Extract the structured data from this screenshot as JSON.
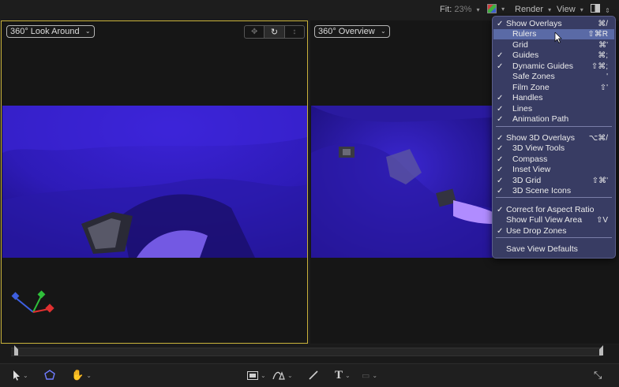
{
  "toolbar": {
    "fit_label": "Fit:",
    "fit_value": "23%",
    "render_label": "Render",
    "view_label": "View",
    "channels_icon": "color-channels-icon",
    "layout_icon": "viewport-layout-icon"
  },
  "left_viewport": {
    "camera_popup": "360° Look Around",
    "tools": [
      "pan-icon",
      "orbit-icon",
      "dolly-icon"
    ]
  },
  "right_viewport": {
    "camera_popup": "360° Overview"
  },
  "view_menu": {
    "items": [
      {
        "label": "Show Overlays",
        "checked": true,
        "shortcut": "⌘/",
        "indent": false
      },
      {
        "label": "Rulers",
        "checked": false,
        "shortcut": "⇧⌘R",
        "indent": true,
        "highlighted": true
      },
      {
        "label": "Grid",
        "checked": false,
        "shortcut": "⌘'",
        "indent": true
      },
      {
        "label": "Guides",
        "checked": true,
        "shortcut": "⌘;",
        "indent": true
      },
      {
        "label": "Dynamic Guides",
        "checked": true,
        "shortcut": "⇧⌘;",
        "indent": true
      },
      {
        "label": "Safe Zones",
        "checked": false,
        "shortcut": "'",
        "indent": true
      },
      {
        "label": "Film Zone",
        "checked": false,
        "shortcut": "⇧'",
        "indent": true
      },
      {
        "label": "Handles",
        "checked": true,
        "shortcut": "",
        "indent": true
      },
      {
        "label": "Lines",
        "checked": true,
        "shortcut": "",
        "indent": true
      },
      {
        "label": "Animation Path",
        "checked": true,
        "shortcut": "",
        "indent": true
      },
      {
        "label": "Show 3D Overlays",
        "checked": true,
        "shortcut": "⌥⌘/",
        "indent": false
      },
      {
        "label": "3D View Tools",
        "checked": true,
        "shortcut": "",
        "indent": true
      },
      {
        "label": "Compass",
        "checked": true,
        "shortcut": "",
        "indent": true
      },
      {
        "label": "Inset View",
        "checked": true,
        "shortcut": "",
        "indent": true
      },
      {
        "label": "3D Grid",
        "checked": true,
        "shortcut": "⇧⌘'",
        "indent": true
      },
      {
        "label": "3D Scene Icons",
        "checked": true,
        "shortcut": "",
        "indent": true
      },
      {
        "label": "Correct for Aspect Ratio",
        "checked": true,
        "shortcut": "",
        "indent": false
      },
      {
        "label": "Show Full View Area",
        "checked": false,
        "shortcut": "⇧V",
        "indent": false
      },
      {
        "label": "Use Drop Zones",
        "checked": true,
        "shortcut": "",
        "indent": false
      },
      {
        "label": "Save View Defaults",
        "checked": false,
        "shortcut": "",
        "indent": false
      }
    ],
    "check_glyph": "✓"
  },
  "bottom_tools": {
    "select_tool": "arrow-select-icon",
    "shape_tool": "3d-transform-icon",
    "pan_tool": "hand-icon",
    "mask_tool": "rectangle-mask-icon",
    "bezier_tool": "pen-icon",
    "paint_tool": "paint-stroke-icon",
    "text_tool_label": "T",
    "expand_tool": "expand-arrows-icon"
  },
  "colors": {
    "accent_yellow": "#c9b23a",
    "scene_purple": "#3a22cc",
    "menu_bg": "#3e426e",
    "menu_highlight": "#5a6aa6"
  }
}
